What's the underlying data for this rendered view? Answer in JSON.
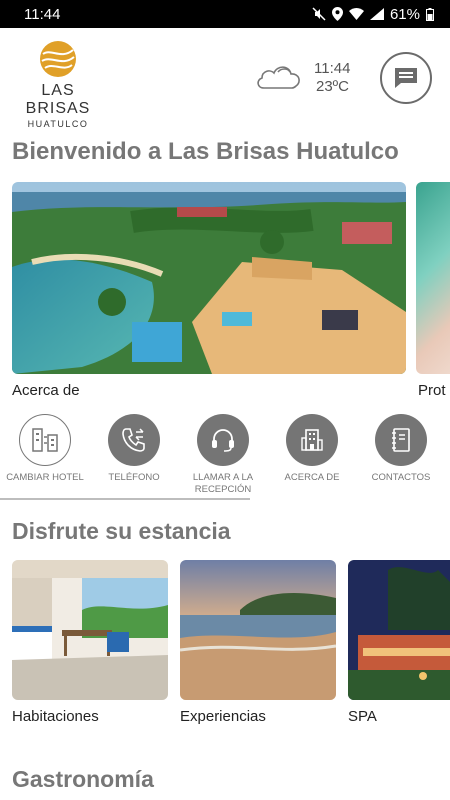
{
  "status_bar": {
    "time": "11:44",
    "battery": "61%"
  },
  "brand": {
    "name": "LAS BRISAS",
    "location": "HUATULCO"
  },
  "weather": {
    "time": "11:44",
    "temperature": "23ºC",
    "icon": "cloud-icon"
  },
  "welcome_title": "Bienvenido a Las Brisas Huatulco",
  "carousel": [
    {
      "label": "Acerca de",
      "image": "resort-aerial-photo"
    },
    {
      "label": "Prot",
      "image": "promo-photo"
    }
  ],
  "quick_actions": [
    {
      "label": "CAMBIAR HOTEL",
      "icon": "hotels-icon",
      "style": "outline"
    },
    {
      "label": "TELÉFONO",
      "icon": "phone-icon",
      "style": "filled"
    },
    {
      "label": "LLAMAR A LA RECEPCIÓN",
      "icon": "headset-icon",
      "style": "filled"
    },
    {
      "label": "ACERCA DE",
      "icon": "building-icon",
      "style": "filled"
    },
    {
      "label": "CONTACTOS",
      "icon": "address-book-icon",
      "style": "filled"
    }
  ],
  "stay_section": {
    "title": "Disfrute su estancia",
    "items": [
      {
        "label": "Habitaciones"
      },
      {
        "label": "Experiencias"
      },
      {
        "label": "SPA"
      }
    ]
  },
  "gastronomy_title": "Gastronomía",
  "colors": {
    "logo_gold": "#e0a028",
    "section_gray": "#777777",
    "icon_fill": "#757575"
  }
}
